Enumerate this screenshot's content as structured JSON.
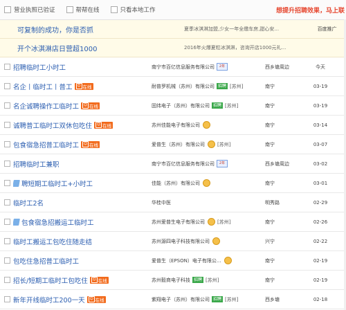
{
  "filters": {
    "license_label": "营业执照已验证",
    "online_label": "帮帮在线",
    "local_only_label": "只看本地工作",
    "promo_text": "想提升招聘效果，马上联"
  },
  "ads": [
    {
      "title": "可复制的成功，你是否抓",
      "desc": "夏季冰淇淋加盟,少女一年全缴车房,甜心安...",
      "tag": "百度推广"
    },
    {
      "title": "开个冰淇淋店日营超1000",
      "desc": "2016年火爆夏粒冰淇淋，咨询开店1000元礼...",
      "tag": ""
    }
  ],
  "jobs": [
    {
      "title": "招聘临时工小时工",
      "online": false,
      "company": "南宁市百亿信息服务有限公司",
      "company_tag": "vip",
      "region": "",
      "location": "西乡塘周边",
      "date": "今天"
    },
    {
      "title": "名企丨临时工丨普工",
      "online": true,
      "company": "耐普罗机械（苏州）有限公司",
      "company_tag": "green",
      "region": "[苏州]",
      "location": "南宁",
      "date": "03-19"
    },
    {
      "title": "名企诚聘操作工临时工",
      "online": true,
      "company": "固纬电子（苏州）有限公司",
      "company_tag": "green",
      "region": "[苏州]",
      "location": "南宁",
      "date": "03-19"
    },
    {
      "title": "诚聘普工临时工双休包吃住",
      "online": true,
      "company": "苏州佳能电子有限公司",
      "company_tag": "face",
      "region": "",
      "location": "南宁",
      "date": "03-14"
    },
    {
      "title": "包食宿急招普工临时工",
      "online": true,
      "company": "爱普生（苏州）有限公司",
      "company_tag": "face",
      "region": "[苏州]",
      "location": "南宁",
      "date": "03-07"
    },
    {
      "title": "招聘临时工兼职",
      "online": false,
      "company": "南宁市百亿信息服务有限公司",
      "company_tag": "vip",
      "region": "",
      "location": "西乡塘周边",
      "date": "03-02"
    },
    {
      "title": "聘短期工临时工+小时工",
      "online": false,
      "company": "佳能（苏州）有限公司",
      "company_tag": "face",
      "region": "",
      "location": "南宁",
      "date": "03-01",
      "pinned": true
    },
    {
      "title": "临时工2名",
      "online": false,
      "company": "华桂中医",
      "company_tag": "",
      "region": "",
      "location": "明秀路",
      "date": "02-29"
    },
    {
      "title": "包食宿急招搬运工临时工",
      "online": false,
      "company": "苏州爱普生电子有限公司",
      "company_tag": "face",
      "region": "[苏州]",
      "location": "南宁",
      "date": "02-26",
      "pinned": true
    },
    {
      "title": "临时工搬运工包吃住随走结",
      "online": false,
      "company": "苏州源四电子科技有限公司",
      "company_tag": "face",
      "region": "",
      "location": "兴宁",
      "date": "02-22"
    },
    {
      "title": "包吃住急招普工临时工",
      "online": false,
      "company": "爱普生（EPSON）电子有限公...",
      "company_tag": "face",
      "region": "",
      "location": "南宁",
      "date": "02-19"
    },
    {
      "title": "招长/短期工临时工包吃住",
      "online": true,
      "company": "苏州毅商电子科技",
      "company_tag": "green",
      "region": "[苏州]",
      "location": "南宁",
      "date": "02-19"
    },
    {
      "title": "新年开线临时工200一天",
      "online": true,
      "company": "紫翔电子（苏州）有限公司",
      "company_tag": "green",
      "region": "[苏州]",
      "location": "西乡塘",
      "date": "02-18"
    }
  ],
  "badges": {
    "online_text": "在线",
    "green_tag_text": "招聘",
    "vip_tag_text": "2年"
  },
  "colors": {
    "link_blue": "#2a5db0",
    "promo_red": "#e6462e",
    "online_orange": "#f26a1b",
    "ad_background": "#fffbe8"
  }
}
